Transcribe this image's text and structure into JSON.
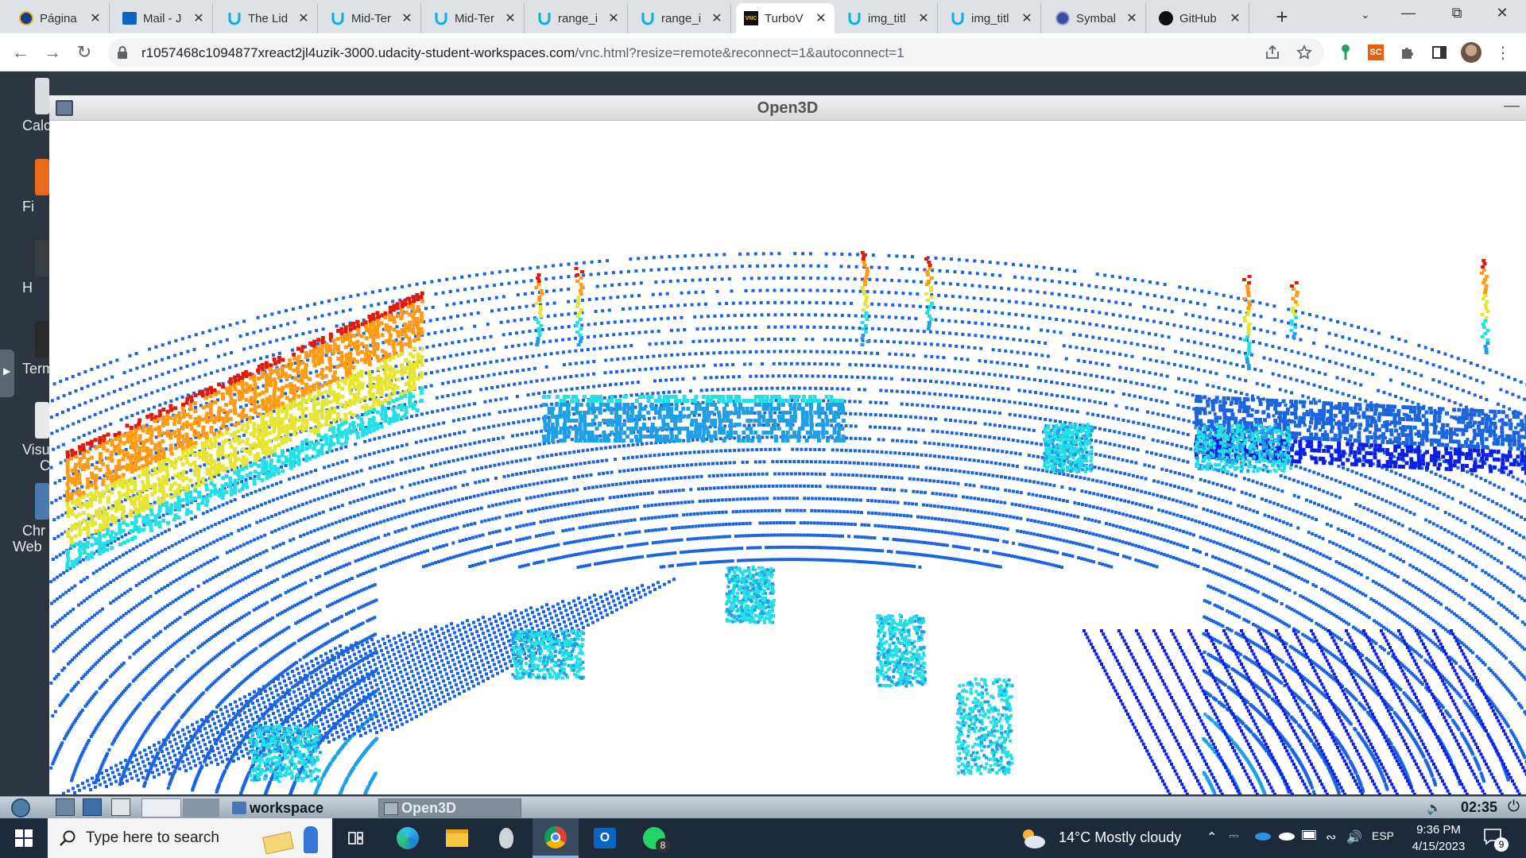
{
  "browser": {
    "tabs": [
      {
        "title": "Página",
        "icon": "tab-favicon-globe"
      },
      {
        "title": "Mail - J",
        "icon": "tab-favicon-outlook"
      },
      {
        "title": "The Lid",
        "icon": "tab-favicon-udacity"
      },
      {
        "title": "Mid-Ter",
        "icon": "tab-favicon-udacity"
      },
      {
        "title": "Mid-Ter",
        "icon": "tab-favicon-udacity"
      },
      {
        "title": "range_i",
        "icon": "tab-favicon-udacity"
      },
      {
        "title": "range_i",
        "icon": "tab-favicon-udacity"
      },
      {
        "title": "TurboV",
        "icon": "tab-favicon-vnc",
        "active": true
      },
      {
        "title": "img_titl",
        "icon": "tab-favicon-udacity"
      },
      {
        "title": "img_titl",
        "icon": "tab-favicon-udacity"
      },
      {
        "title": "Symbal",
        "icon": "tab-favicon-symbaloo"
      },
      {
        "title": "GitHub",
        "icon": "tab-favicon-github"
      }
    ],
    "url_main": "r1057468c1094877xreact2jl4uzik-3000.udacity-student-workspaces.com",
    "url_path": "/vnc.html?resize=remote&reconnect=1&autoconnect=1"
  },
  "desktop": {
    "icons": [
      {
        "label": "Calc",
        "color": "#d9dde2"
      },
      {
        "label": "Fi",
        "color": "#e86a1a"
      },
      {
        "label": "H",
        "color": "#3a3f44"
      },
      {
        "label": "Term",
        "color": "#2a2a2a"
      },
      {
        "label": "Visua",
        "label2": "C",
        "color": "#e8e8e8"
      },
      {
        "label": "Chr",
        "label2": "Web",
        "color": "#4a7ab0"
      }
    ]
  },
  "open3d": {
    "title": "Open3D",
    "visual": {
      "background": "#ffffff",
      "colormap": [
        "#0a1ee6",
        "#1a64e0",
        "#1ea0e8",
        "#22e0e6",
        "#e6e632",
        "#ff9a12",
        "#e01a0a"
      ]
    }
  },
  "remote_taskbar": {
    "tasks": [
      {
        "label": "workspace",
        "icon": "folder-icon"
      },
      {
        "label": "Open3D",
        "icon": "window-icon"
      }
    ],
    "clock": "02:35"
  },
  "windows_taskbar": {
    "search_placeholder": "Type here to search",
    "weather": "14°C  Mostly cloudy",
    "language": "ESP",
    "time": "9:36 PM",
    "date": "4/15/2023",
    "notification_count": "9",
    "whatsapp_badge": "8"
  }
}
